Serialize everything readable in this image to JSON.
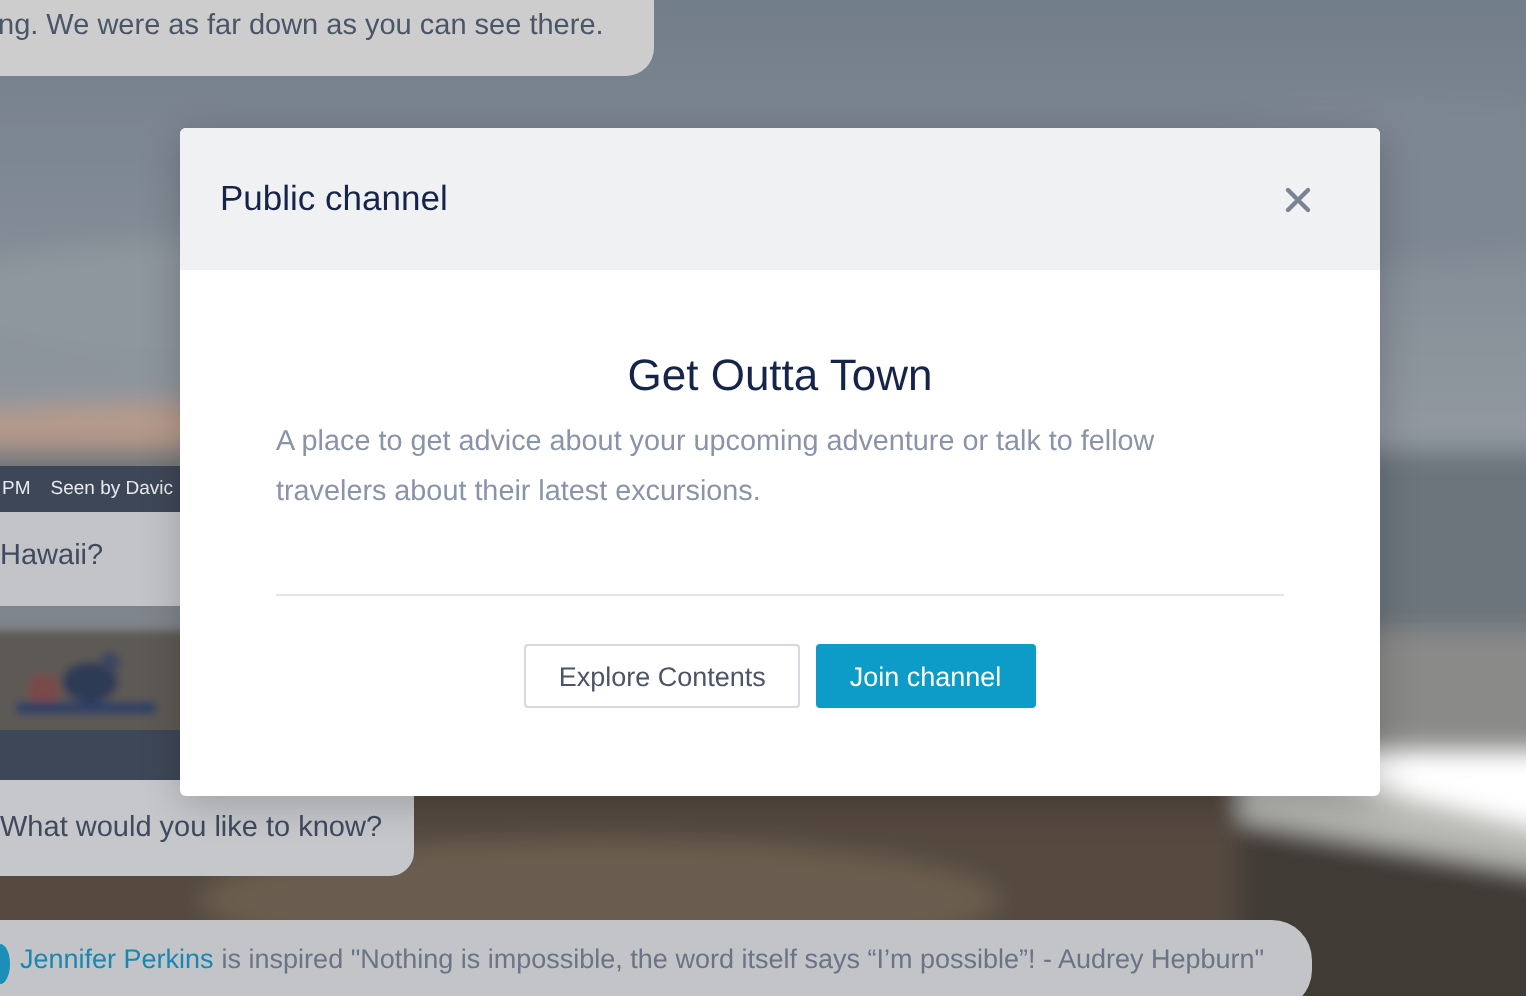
{
  "chat": {
    "top_message": "ng. We were as far down as you can see there.",
    "meta": {
      "time": "PM",
      "seen": "Seen by Davic"
    },
    "question": "Hawaii?",
    "answer": "What would you like to know?",
    "activity": {
      "user": "Jennifer Perkins",
      "text": "is inspired \"Nothing is impossible, the word itself says “I’m possible”! - Audrey Hepburn\""
    }
  },
  "modal": {
    "header": "Public channel",
    "title": "Get Outta Town",
    "description": "A place to get advice about your upcoming adventure or talk to fellow travelers about their latest excursions.",
    "buttons": [
      {
        "label": "Explore Contents",
        "kind": "secondary"
      },
      {
        "label": "Join channel",
        "kind": "primary"
      }
    ]
  }
}
